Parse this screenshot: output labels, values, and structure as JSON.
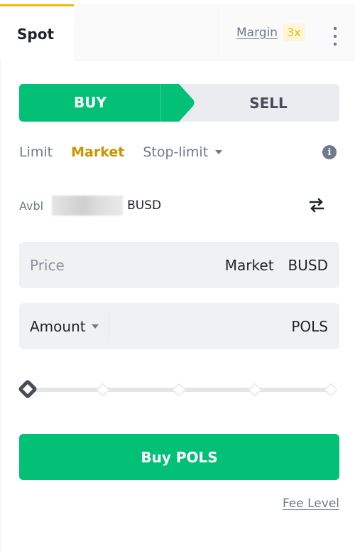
{
  "header": {
    "tabs": [
      {
        "label": "Spot",
        "active": true
      },
      {
        "label": "Margin",
        "badge": "3x",
        "active": false
      }
    ],
    "more_icon": "vertical-ellipsis-icon"
  },
  "side": {
    "buy_label": "BUY",
    "sell_label": "SELL",
    "selected": "BUY"
  },
  "order_types": {
    "items": [
      "Limit",
      "Market",
      "Stop-limit"
    ],
    "selected": "Market",
    "info_icon": "info-icon"
  },
  "available": {
    "label": "Avbl",
    "value_hidden": true,
    "currency": "BUSD",
    "swap_icon": "swap-arrows-icon"
  },
  "price_field": {
    "placeholder": "Price",
    "value": "Market",
    "unit": "BUSD"
  },
  "amount_field": {
    "label": "Amount",
    "unit": "POLS"
  },
  "slider": {
    "value_percent": 0,
    "marks_percent": [
      0,
      25,
      50,
      75,
      100
    ]
  },
  "submit": {
    "label": "Buy POLS"
  },
  "footer": {
    "fee_level_label": "Fee Level"
  },
  "colors": {
    "buy_green": "#02c076",
    "accent_yellow": "#f0b90b",
    "active_order_type": "#c99400",
    "muted_text": "#707a8a"
  }
}
